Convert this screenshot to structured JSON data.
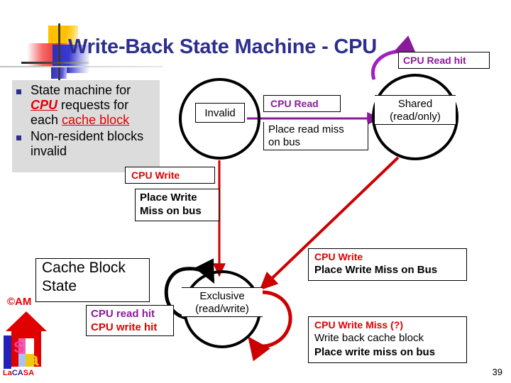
{
  "slide": {
    "title": "Write-Back State Machine - CPU",
    "page_number": "39"
  },
  "bullets": [
    {
      "pre": "State machine for ",
      "em1": "CPU",
      "mid": " requests for each ",
      "em2": "cache block"
    },
    {
      "text": "Non-resident blocks invalid"
    }
  ],
  "states": {
    "invalid": {
      "line1": "Invalid",
      "line2": ""
    },
    "shared": {
      "line1": "Shared",
      "line2": "(read/only)"
    },
    "exclusive": {
      "line1": "Exclusive",
      "line2": "(read/write)"
    }
  },
  "transitions": {
    "cpu_read_hit_top": "CPU Read hit",
    "cpu_read": {
      "event": "CPU Read",
      "action_line1": "Place read miss",
      "action_line2": "on bus"
    },
    "cpu_write_left": {
      "event": "CPU Write",
      "action_line1": "Place Write",
      "action_line2": "Miss on bus"
    },
    "cpu_write_right": {
      "event": "CPU Write",
      "action": "Place Write Miss on Bus"
    },
    "cpu_write_miss": {
      "event": "CPU Write Miss (?)",
      "action_line1": "Write back cache block",
      "action_line2": "Place write miss on bus"
    },
    "self_hits": {
      "read": "CPU read hit",
      "write": "CPU write hit"
    }
  },
  "legend": {
    "cache_block_state_line1": "Cache Block",
    "cache_block_state_line2": "State"
  },
  "logo": {
    "am": "©AM",
    "name_1": "La",
    "name_2": "CA",
    "name_3": "SA"
  },
  "colors": {
    "title": "#2d2d8f",
    "purple": "#8b1a9b",
    "red": "#e00000",
    "panel": "#dcdcdc"
  }
}
